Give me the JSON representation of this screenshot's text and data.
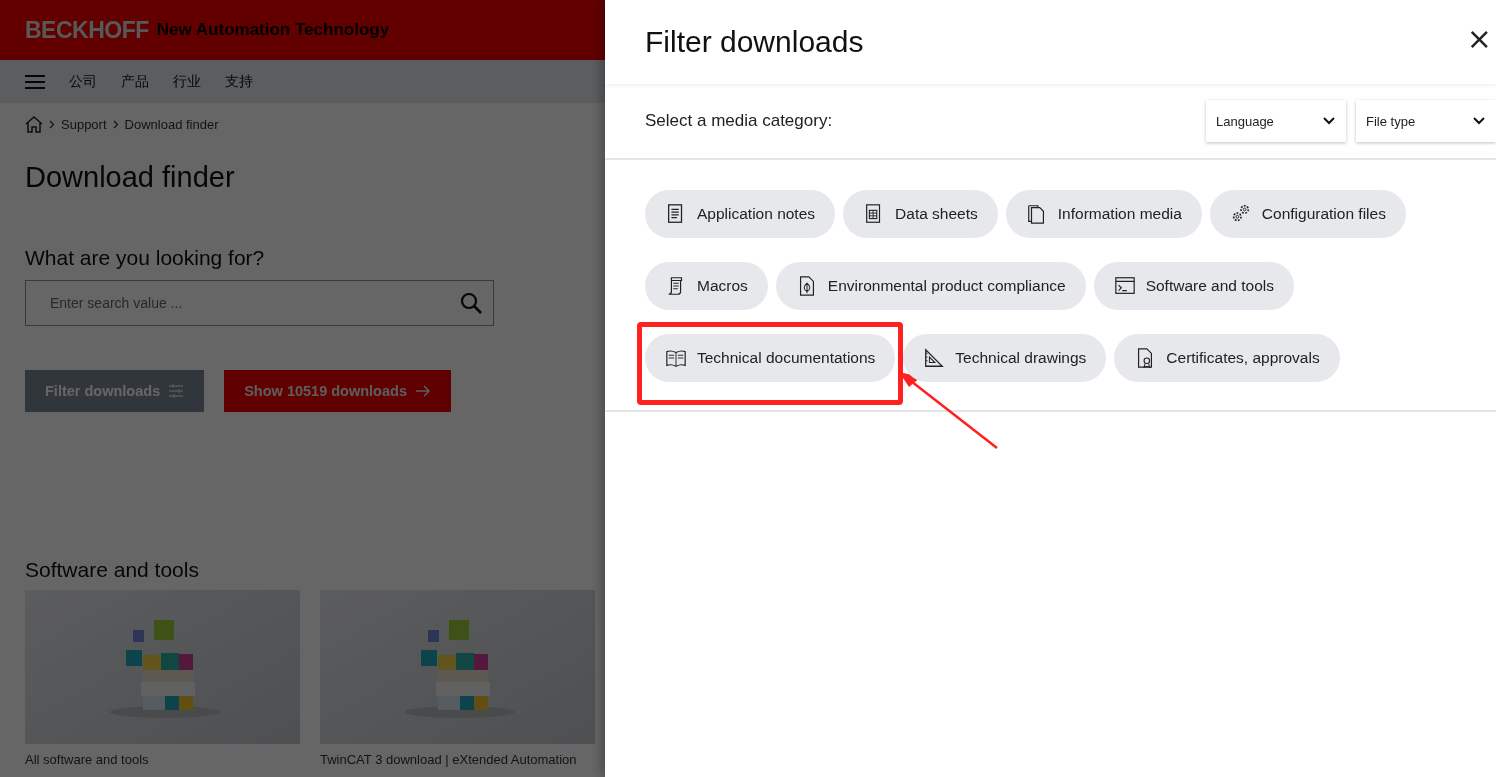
{
  "header": {
    "logo": "BECKHOFF",
    "tagline": "New Automation Technology"
  },
  "nav": {
    "items": [
      "公司",
      "产品",
      "行业",
      "支持"
    ]
  },
  "breadcrumb": [
    "Support",
    "Download finder"
  ],
  "page_title": "Download finder",
  "search": {
    "label": "What are you looking for?",
    "placeholder": "Enter search value ..."
  },
  "buttons": {
    "filter": "Filter downloads",
    "show": "Show 10519 downloads"
  },
  "section": {
    "title": "Software and tools",
    "cards": [
      {
        "caption": "All software and tools"
      },
      {
        "caption": "TwinCAT 3 download | eXtended Automation"
      }
    ]
  },
  "filter_panel": {
    "title": "Filter downloads",
    "close": "×",
    "prompt": "Select a media category:",
    "selects": [
      "Language",
      "File type"
    ],
    "category_rows": [
      [
        {
          "label": "Application notes",
          "highlighted": false
        },
        {
          "label": "Data sheets",
          "highlighted": false
        },
        {
          "label": "Information media",
          "highlighted": false
        },
        {
          "label": "Configuration files",
          "highlighted": false
        }
      ],
      [
        {
          "label": "Macros",
          "highlighted": false
        },
        {
          "label": "Environmental product compliance",
          "highlighted": false
        },
        {
          "label": "Software and tools",
          "highlighted": false
        }
      ],
      [
        {
          "label": "Technical documentations",
          "highlighted": true
        },
        {
          "label": "Technical drawings",
          "highlighted": false
        },
        {
          "label": "Certificates, approvals",
          "highlighted": false
        }
      ]
    ]
  }
}
